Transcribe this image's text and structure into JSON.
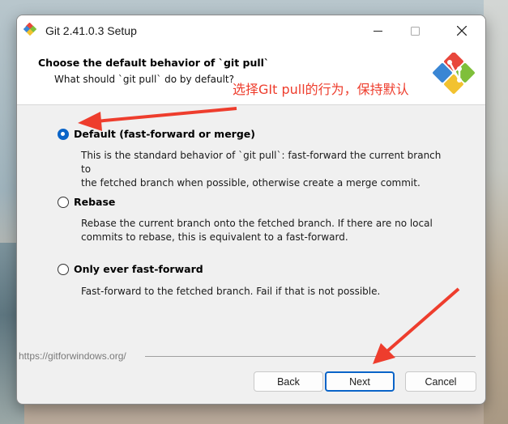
{
  "window": {
    "title": "Git 2.41.0.3 Setup",
    "controls": {
      "minimize": "—",
      "maximize": "☐",
      "close": "✕"
    }
  },
  "header": {
    "title": "Choose the default behavior of `git pull`",
    "subtitle": "What should `git pull` do by default?"
  },
  "annotation": {
    "text": "选择GIt pull的行为，保持默认",
    "color": "#ee3d2d"
  },
  "options": [
    {
      "label": "Default (fast-forward or merge)",
      "checked": true,
      "desc1": "This is the standard behavior of `git pull`: fast-forward the current branch to",
      "desc2": "the fetched branch when possible, otherwise create a merge commit."
    },
    {
      "label": "Rebase",
      "checked": false,
      "desc1": "Rebase the current branch onto the fetched branch. If there are no local",
      "desc2": "commits to rebase, this is equivalent to a fast-forward."
    },
    {
      "label": "Only ever fast-forward",
      "checked": false,
      "desc1": "Fast-forward to the fetched branch. Fail if that is not possible.",
      "desc2": ""
    }
  ],
  "footer": {
    "url": "https://gitforwindows.org/",
    "back": "Back",
    "next": "Next",
    "cancel": "Cancel"
  },
  "colors": {
    "accent": "#0a64c8",
    "annotation": "#ee3d2d"
  }
}
